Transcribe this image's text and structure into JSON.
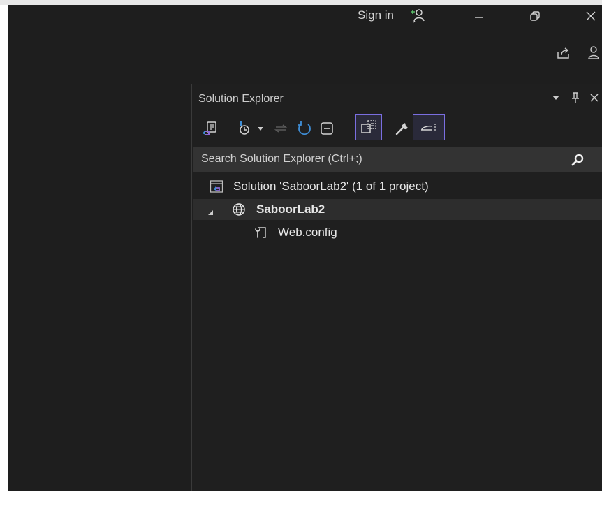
{
  "titlebar": {
    "sign_in_label": "Sign in",
    "icons": [
      "add-account-icon",
      "minimize-icon",
      "restore-icon",
      "close-icon",
      "share-icon",
      "profile-icon"
    ]
  },
  "solution_explorer": {
    "title": "Solution Explorer",
    "header_icons": [
      "dropdown-arrow-icon",
      "pin-icon",
      "close-icon"
    ],
    "toolbar_icons": [
      "switch-views-icon",
      "pending-changes-filter-icon",
      "dropdown-icon",
      "sync-icon",
      "refresh-icon",
      "collapse-all-icon",
      "show-all-files-icon",
      "properties-icon",
      "preview-selected-items-icon"
    ],
    "search_placeholder": "Search Solution Explorer (Ctrl+;)",
    "tree": [
      {
        "label": "Solution 'SaboorLab2' (1 of 1 project)",
        "icon": "solution-icon",
        "level": 0
      },
      {
        "label": "SaboorLab2",
        "icon": "globe-icon",
        "level": 1,
        "expanded": true,
        "bold": true
      },
      {
        "label": "Web.config",
        "icon": "config-file-icon",
        "level": 2
      }
    ]
  },
  "colors": {
    "background": "#1e1e1e",
    "active_border": "#7a6ee0",
    "accent_blue": "#3f8fd8",
    "accent_green": "#5bbf6a"
  }
}
